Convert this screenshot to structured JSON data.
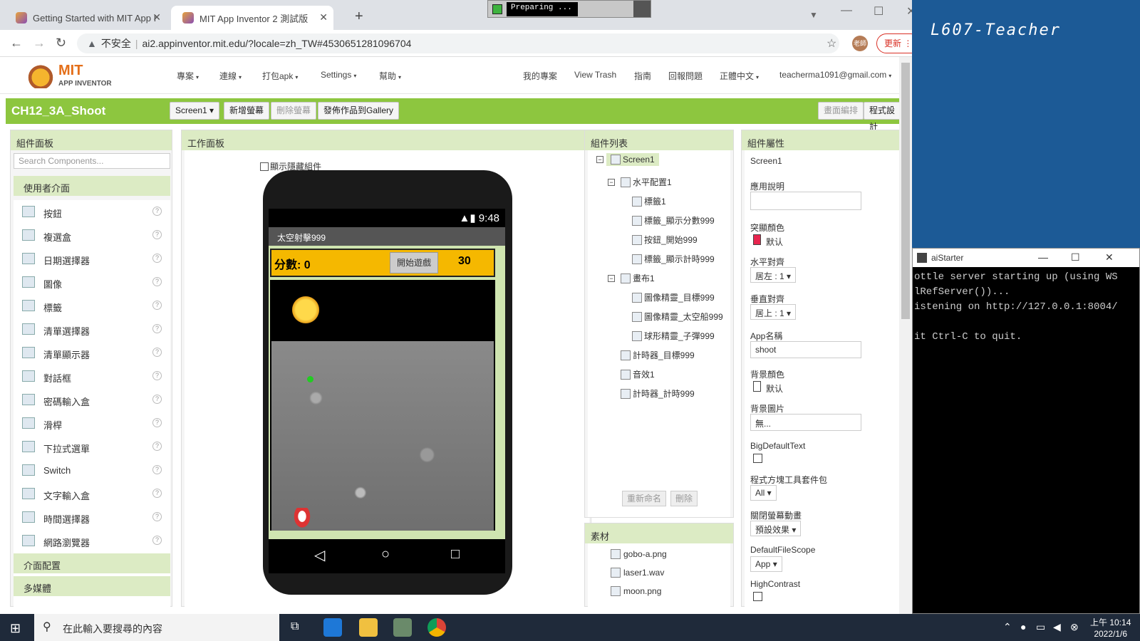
{
  "browser": {
    "tabs": [
      {
        "label": "Getting Started with MIT App I"
      },
      {
        "label": "MIT App Inventor 2 測試版"
      }
    ],
    "preparing": "Preparing ...",
    "url_warning": "不安全",
    "url": "ai2.appinventor.mit.edu/?locale=zh_TW#4530651281096704",
    "avatar": "老師",
    "update_label": "更新"
  },
  "header": {
    "logo_mit": "MIT",
    "logo_sub": "APP INVENTOR",
    "menus": [
      "專案",
      "連線",
      "打包apk",
      "Settings",
      "幫助"
    ],
    "links": [
      "我的專案",
      "View Trash",
      "指南",
      "回報問題",
      "正體中文",
      "teacherma1091@gmail.com"
    ]
  },
  "toolbar": {
    "project_name": "CH12_3A_Shoot",
    "screen_select": "Screen1",
    "add_screen": "新增螢幕",
    "remove_screen": "刪除螢幕",
    "publish": "發佈作品到Gallery",
    "designer": "畫面編排",
    "blocks": "程式設計"
  },
  "palette": {
    "title": "組件面板",
    "search_placeholder": "Search Components...",
    "category_ui": "使用者介面",
    "items": [
      "按鈕",
      "複選盒",
      "日期選擇器",
      "圖像",
      "標籤",
      "清單選擇器",
      "清單顯示器",
      "對話框",
      "密碼輸入盒",
      "滑桿",
      "下拉式選單",
      "Switch",
      "文字輸入盒",
      "時間選擇器",
      "網路瀏覽器"
    ],
    "category_layout": "介面配置",
    "category_media": "多媒體"
  },
  "viewer": {
    "title": "工作面板",
    "show_hidden": "顯示隱藏組件",
    "status_time": "9:48",
    "app_title": "太空射擊999",
    "score_label": "分數:",
    "score_value": "0",
    "start_button": "開始遊戲",
    "timer_value": "30"
  },
  "components": {
    "title": "組件列表",
    "screen": "Screen1",
    "nodes": [
      "水平配置1",
      "標籤1",
      "標籤_顯示分數999",
      "按鈕_開始999",
      "標籤_顯示計時999",
      "畫布1",
      "圖像精靈_目標999",
      "圖像精靈_太空船999",
      "球形精靈_子彈999",
      "計時器_目標999",
      "音效1",
      "計時器_計時999"
    ],
    "rename": "重新命名",
    "delete": "刪除"
  },
  "assets": {
    "title": "素材",
    "files": [
      "gobo-a.png",
      "laser1.wav",
      "moon.png"
    ]
  },
  "properties": {
    "title": "組件屬性",
    "component": "Screen1",
    "about_label": "應用說明",
    "accent_label": "突顯顏色",
    "accent_value": "默认",
    "accent_color": "#e8254f",
    "halign_label": "水平對齊",
    "halign_value": "居左 : 1",
    "valign_label": "垂直對齊",
    "valign_value": "居上 : 1",
    "appname_label": "App名稱",
    "appname_value": "shoot",
    "bgcolor_label": "背景顏色",
    "bgcolor_value": "默认",
    "bgimage_label": "背景圖片",
    "bgimage_value": "無...",
    "bigtext_label": "BigDefaultText",
    "blocks_label": "程式方塊工具套件包",
    "blocks_value": "All",
    "close_anim_label": "關閉螢幕動畫",
    "close_anim_value": "預設效果",
    "filescope_label": "DefaultFileScope",
    "filescope_value": "App",
    "contrast_label": "HighContrast"
  },
  "desktop": {
    "machine_name": "L607-Teacher",
    "console_title": "aiStarter",
    "console_lines": [
      "ottle server starting up (using WS",
      "lRefServer())...",
      "istening on http://127.0.0.1:8004/",
      "",
      "it Ctrl-C to quit."
    ]
  },
  "taskbar": {
    "search_placeholder": "在此輸入要搜尋的內容",
    "time": "上午 10:14",
    "date": "2022/1/6"
  }
}
